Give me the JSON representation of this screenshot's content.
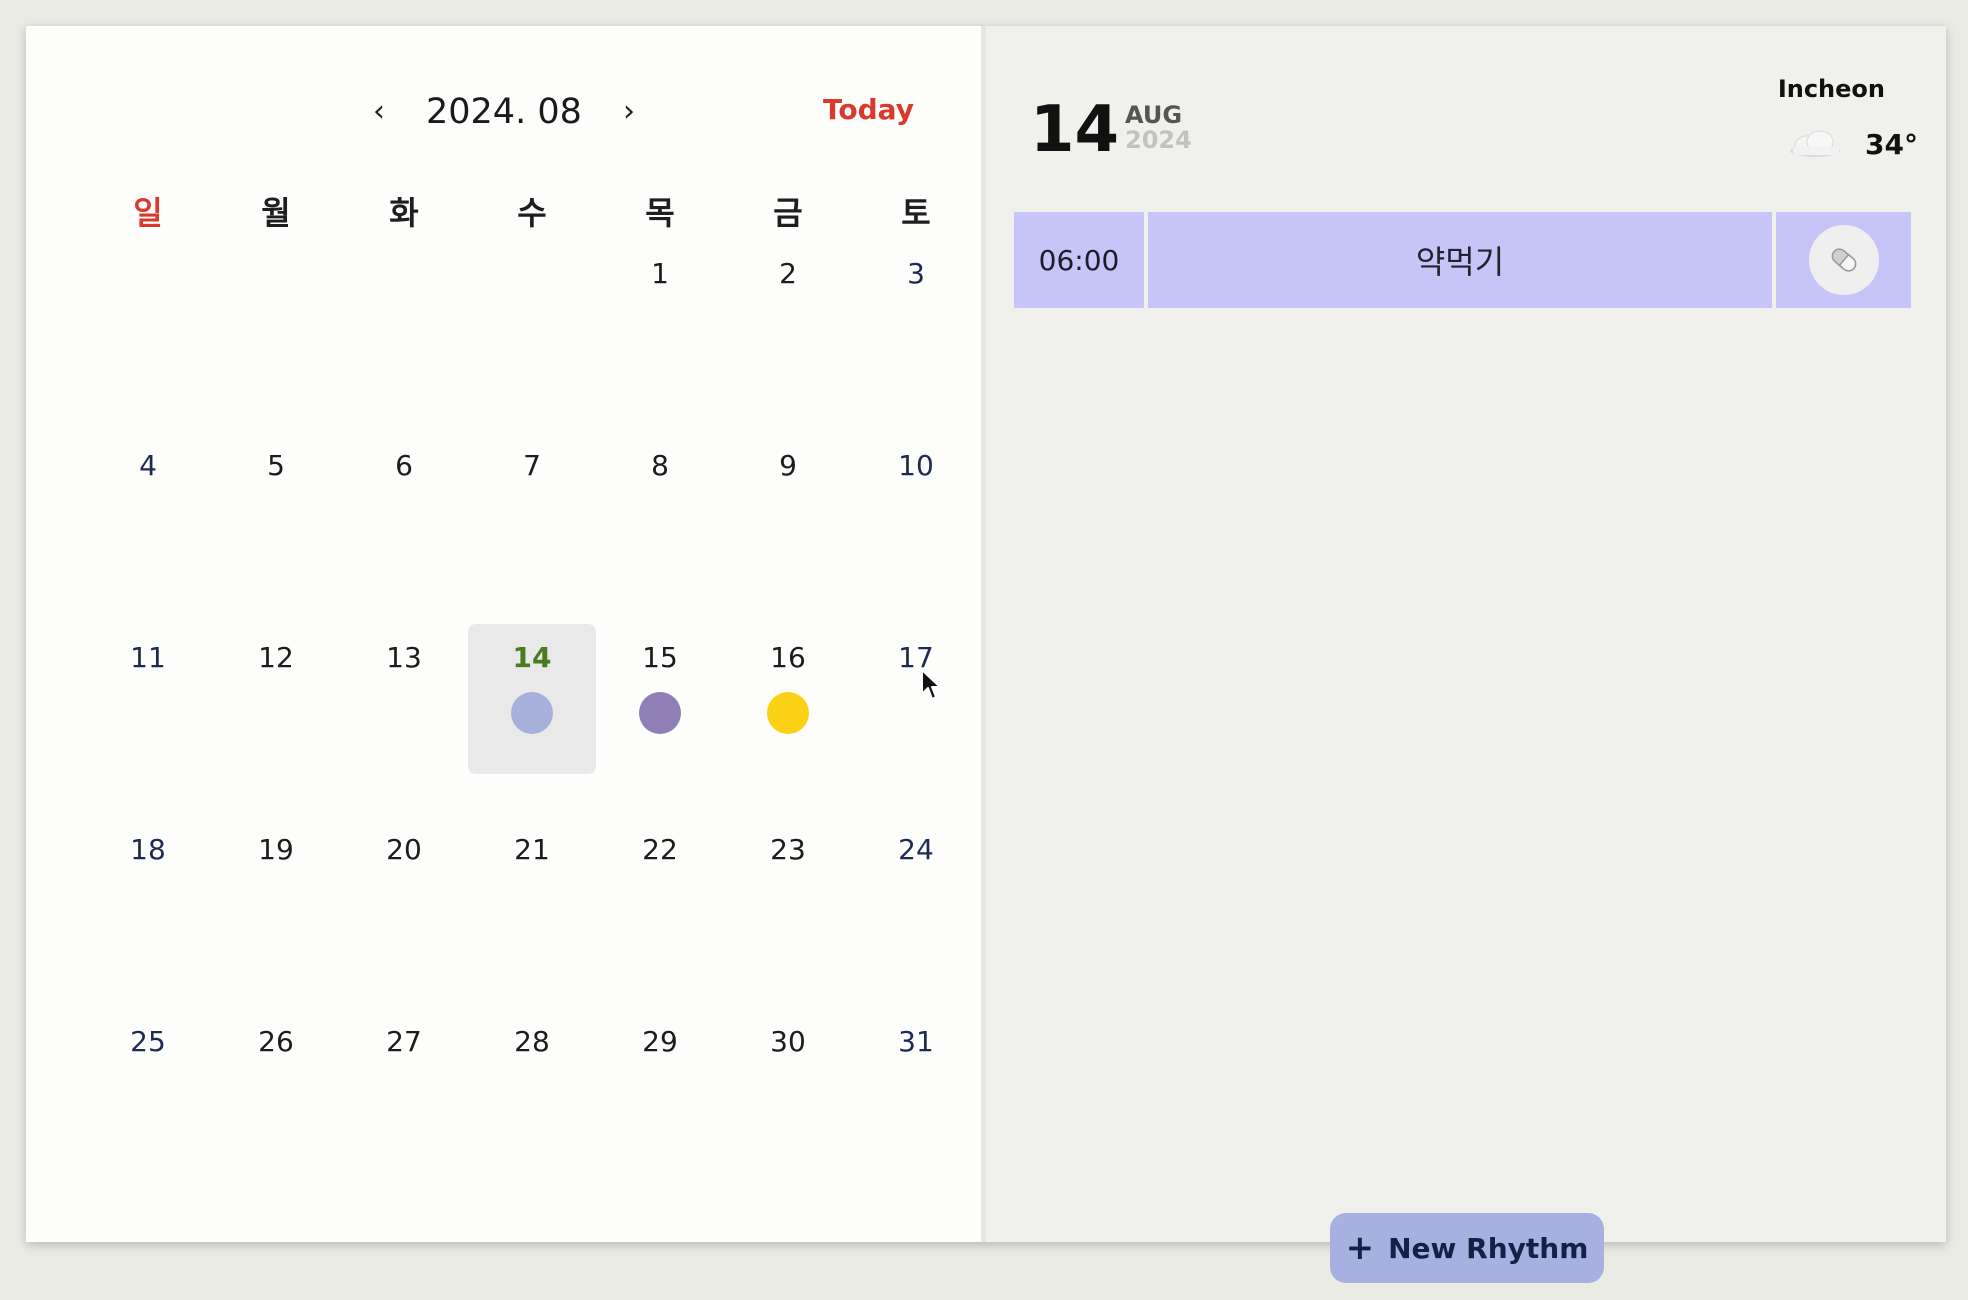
{
  "calendar": {
    "prev_icon": "chevron-left-icon",
    "prev_label": "‹",
    "next_icon": "chevron-right-icon",
    "next_label": "›",
    "month_label": "2024. 08",
    "today_label": "Today",
    "weekdays": [
      "일",
      "월",
      "화",
      "수",
      "목",
      "금",
      "토"
    ],
    "weeks": [
      [
        "",
        "",
        "",
        "",
        "1",
        "2",
        "3"
      ],
      [
        "4",
        "5",
        "6",
        "7",
        "8",
        "9",
        "10"
      ],
      [
        "11",
        "12",
        "13",
        "14",
        "15",
        "16",
        "17"
      ],
      [
        "18",
        "19",
        "20",
        "21",
        "22",
        "23",
        "24"
      ],
      [
        "25",
        "26",
        "27",
        "28",
        "29",
        "30",
        "31"
      ]
    ],
    "selected_day": "14",
    "dots": [
      {
        "day": "14",
        "color": "#a7b1da"
      },
      {
        "day": "15",
        "color": "#8f7fb6"
      },
      {
        "day": "16",
        "color": "#fbd116"
      }
    ],
    "colors": {
      "sunday_header": "#d93a2d",
      "today_button": "#d93a2d",
      "selected_day_text": "#4a7c1f"
    }
  },
  "detail": {
    "day": "14",
    "month": "AUG",
    "year": "2024",
    "city": "Incheon",
    "weather_icon": "cloud-icon",
    "temperature": "34°",
    "rhythms": [
      {
        "time": "06:00",
        "title": "약먹기",
        "icon": "pill-icon",
        "color": "#c7c4f7"
      }
    ]
  },
  "new_rhythm": {
    "plus_label": "+",
    "label": "New Rhythm",
    "color": "#a7b0e0"
  }
}
